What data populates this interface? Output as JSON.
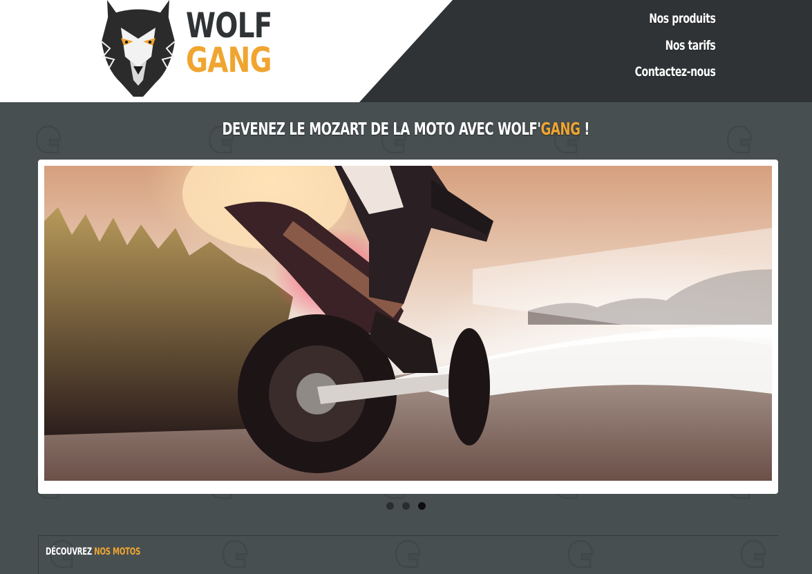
{
  "brand": {
    "logo_icon": "wolf-head-logo",
    "logo_line1": "WOLF",
    "logo_line2": "GANG",
    "colors": {
      "accent": "#f0a530",
      "dark": "#2f3335",
      "page_bg": "#474f51",
      "white": "#ffffff"
    }
  },
  "nav": {
    "items": [
      {
        "label": "Nos produits"
      },
      {
        "label": "Nos tarifs"
      },
      {
        "label": "Contactez-nous"
      }
    ]
  },
  "hero": {
    "title_prefix": "DEVENEZ LE MOZART DE LA MOTO AVEC WOLF'",
    "title_accent": "GANG",
    "title_suffix": " !"
  },
  "slider": {
    "current_slide_image": "motorcycle-rider-at-night-in-cornfield",
    "dots_total": 3,
    "active_dot": 3
  },
  "section": {
    "title_prefix": "DÉCOUVREZ ",
    "title_accent": "NOS MOTOS"
  }
}
